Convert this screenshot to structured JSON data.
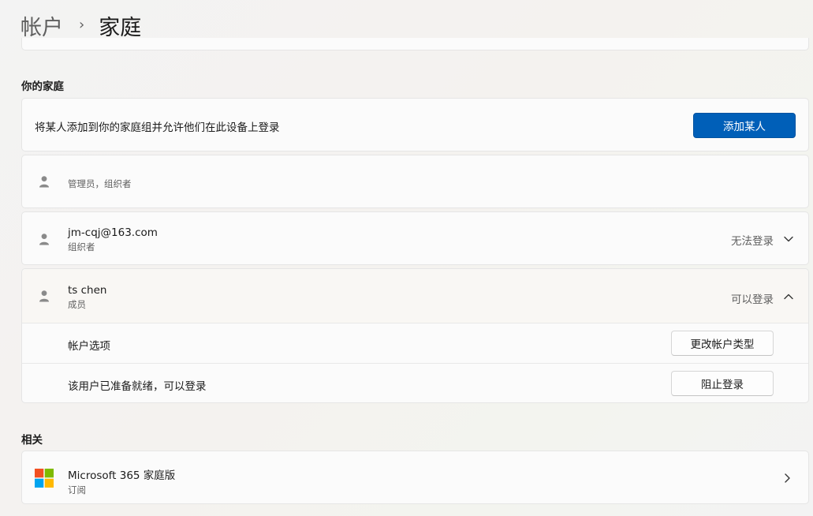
{
  "breadcrumb": {
    "parent": "帐户",
    "separator": "›",
    "current": "家庭"
  },
  "family_section": {
    "title": "你的家庭",
    "add_card": {
      "text": "将某人添加到你的家庭组并允许他们在此设备上登录",
      "button": "添加某人"
    },
    "members": [
      {
        "name": "",
        "role": "管理员，组织者",
        "status": "",
        "icon": "person-icon"
      },
      {
        "name": "jm-cqj@163.com",
        "role": "组织者",
        "status": "无法登录",
        "chevron": "chevron-down-icon"
      },
      {
        "name": "ts chen",
        "role": "成员",
        "status": "可以登录",
        "chevron": "chevron-up-icon",
        "expanded": {
          "account_options_label": "帐户选项",
          "account_options_button": "更改帐户类型",
          "ready_label": "该用户已准备就绪，可以登录",
          "ready_button": "阻止登录"
        }
      }
    ]
  },
  "related_section": {
    "title": "相关",
    "items": [
      {
        "title": "Microsoft 365 家庭版",
        "subtitle": "订阅",
        "icon": "microsoft-logo-icon"
      }
    ]
  },
  "colors": {
    "accent": "#005fb8",
    "ms_red": "#f25022",
    "ms_green": "#7fba00",
    "ms_blue": "#00a4ef",
    "ms_yellow": "#ffb900"
  }
}
